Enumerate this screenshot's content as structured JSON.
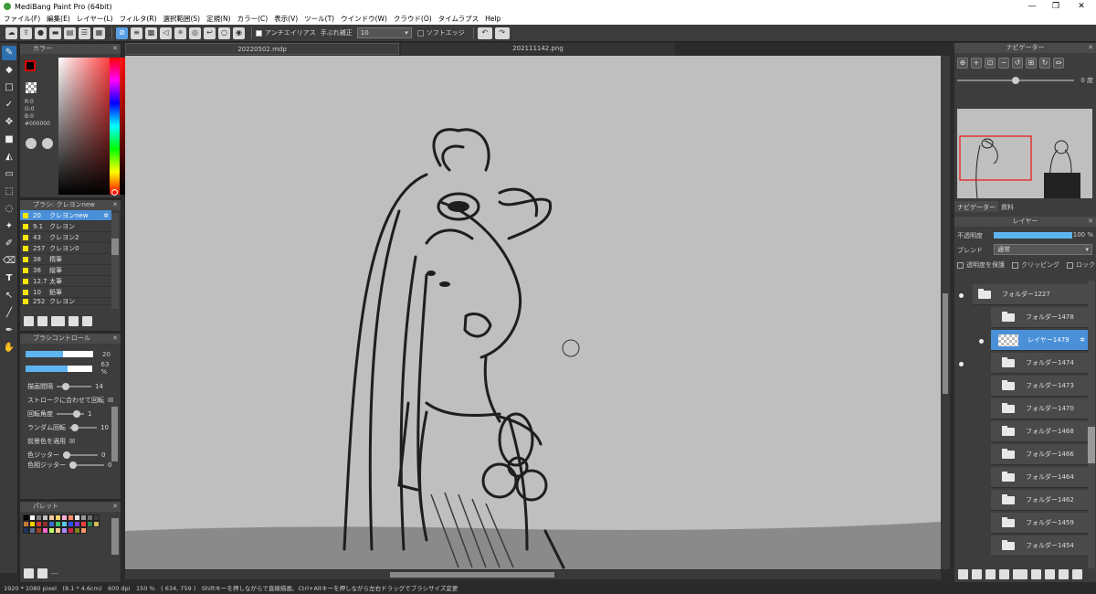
{
  "window": {
    "title": "MediBang Paint Pro (64bit)",
    "minimize": "—",
    "maximize": "❐",
    "close": "✕"
  },
  "menu": [
    "ファイル(F)",
    "編集(E)",
    "レイヤー(L)",
    "フィルタ(R)",
    "選択範囲(S)",
    "定規(N)",
    "カラー(C)",
    "表示(V)",
    "ツール(T)",
    "ウインドウ(W)",
    "クラウド(O)",
    "タイムラプス",
    "Help"
  ],
  "toolbar": {
    "antialias_label": "アンチエイリアス",
    "stabilizer_label": "手ぶれ補正",
    "stabilizer_value": "10",
    "soft_edge_label": "ソフトエッジ"
  },
  "tabs": {
    "doc1": "20220502.mdp",
    "doc2": "202111142.png"
  },
  "color_panel": {
    "title": "カラー",
    "r": "R:0",
    "g": "G:0",
    "b": "B:0",
    "hex": "#000000",
    "foreground_color": "#000000",
    "background_color": "#ffffff"
  },
  "brush_panel": {
    "title": "ブラシ: クレヨンnew",
    "items": [
      {
        "size": "20",
        "name": "クレヨンnew"
      },
      {
        "size": "9.1",
        "name": "クレヨン"
      },
      {
        "size": "43",
        "name": "クレヨン2"
      },
      {
        "size": "257",
        "name": "クレヨン0"
      },
      {
        "size": "38",
        "name": "楕筆"
      },
      {
        "size": "38",
        "name": "縦筆"
      },
      {
        "size": "12.7",
        "name": "太筆"
      },
      {
        "size": "10",
        "name": "鉛筆"
      },
      {
        "size": "252",
        "name": "クレヨン"
      }
    ]
  },
  "brush_control": {
    "title": "ブラシコントロール",
    "size_value": "20",
    "opacity_value": "63 %",
    "size_fill": 0.55,
    "opacity_fill": 0.63,
    "rows": [
      {
        "label": "描画間隔",
        "value": "14"
      },
      {
        "label": "ストロークに合わせて回転",
        "value": "☒"
      },
      {
        "label": "回転角度",
        "value": "1"
      },
      {
        "label": "ランダム回転",
        "value": "10"
      },
      {
        "label": "前景色を適用",
        "value": "☒"
      },
      {
        "label": "色ジッター",
        "value": "0"
      },
      {
        "label": "色相ジッター",
        "value": "0"
      }
    ]
  },
  "palette_panel": {
    "title": "パレット",
    "name": "---",
    "colors": [
      "#000000",
      "#ffffff",
      "#808080",
      "#c0c0c0",
      "#f2c6a0",
      "#f9d26b",
      "#ffb2d9",
      "#ff8c66",
      "#e7e7e7",
      "#9a9a9a",
      "#6f6f6f",
      "#3d3d3d",
      "#c67a3b",
      "#ffd000",
      "#d63a3a",
      "#8a2f2f",
      "#3b6ecf",
      "#42c06a",
      "#59c8e0",
      "#3050ff",
      "#7a3bd6",
      "#ff3c3c",
      "#2e8b57",
      "#d6b75f",
      "#203060",
      "#5a6d8a",
      "#994422",
      "#ff66cc",
      "#c0ff66",
      "#ffcc99",
      "#aa88ff",
      "#cc2244",
      "#808020",
      "#ff9966"
    ]
  },
  "navigator": {
    "title": "ナビゲーター",
    "angle": "0 度",
    "tab_navigator": "ナビゲーター",
    "tab_material": "資料"
  },
  "layer_panel": {
    "title": "レイヤー",
    "opacity_label": "不透明度",
    "opacity_value": "100 %",
    "opacity_fill": 1.0,
    "blend_label": "ブレンド",
    "blend_value": "通常",
    "protect_alpha": "透明度を保護",
    "clipping": "クリッピング",
    "lock": "ロック",
    "layers": [
      {
        "name": "フォルダー1227",
        "type": "folder",
        "visible": true,
        "indent": 0,
        "selected": false
      },
      {
        "name": "フォルダー1478",
        "type": "folder",
        "visible": false,
        "indent": 1,
        "selected": false
      },
      {
        "name": "レイヤー1479",
        "type": "layer",
        "visible": true,
        "indent": 2,
        "selected": true
      },
      {
        "name": "フォルダー1474",
        "type": "folder",
        "visible": true,
        "indent": 1,
        "selected": false
      },
      {
        "name": "フォルダー1473",
        "type": "folder",
        "visible": false,
        "indent": 1,
        "selected": false
      },
      {
        "name": "フォルダー1470",
        "type": "folder",
        "visible": false,
        "indent": 1,
        "selected": false
      },
      {
        "name": "フォルダー1468",
        "type": "folder",
        "visible": false,
        "indent": 1,
        "selected": false
      },
      {
        "name": "フォルダー1466",
        "type": "folder",
        "visible": false,
        "indent": 1,
        "selected": false
      },
      {
        "name": "フォルダー1464",
        "type": "folder",
        "visible": false,
        "indent": 1,
        "selected": false
      },
      {
        "name": "フォルダー1462",
        "type": "folder",
        "visible": false,
        "indent": 1,
        "selected": false
      },
      {
        "name": "フォルダー1459",
        "type": "folder",
        "visible": false,
        "indent": 1,
        "selected": false
      },
      {
        "name": "フォルダー1454",
        "type": "folder",
        "visible": false,
        "indent": 1,
        "selected": false
      }
    ]
  },
  "statusbar": {
    "text": "1920 * 1080 pixel　(8.1 * 4.6cm)　600 dpi　150 %　( 634, 759 )　Shiftキーを押しながらで直線描画、Ctrl+Altキーを押しながら左右ドラッグでブラシサイズ変更"
  }
}
